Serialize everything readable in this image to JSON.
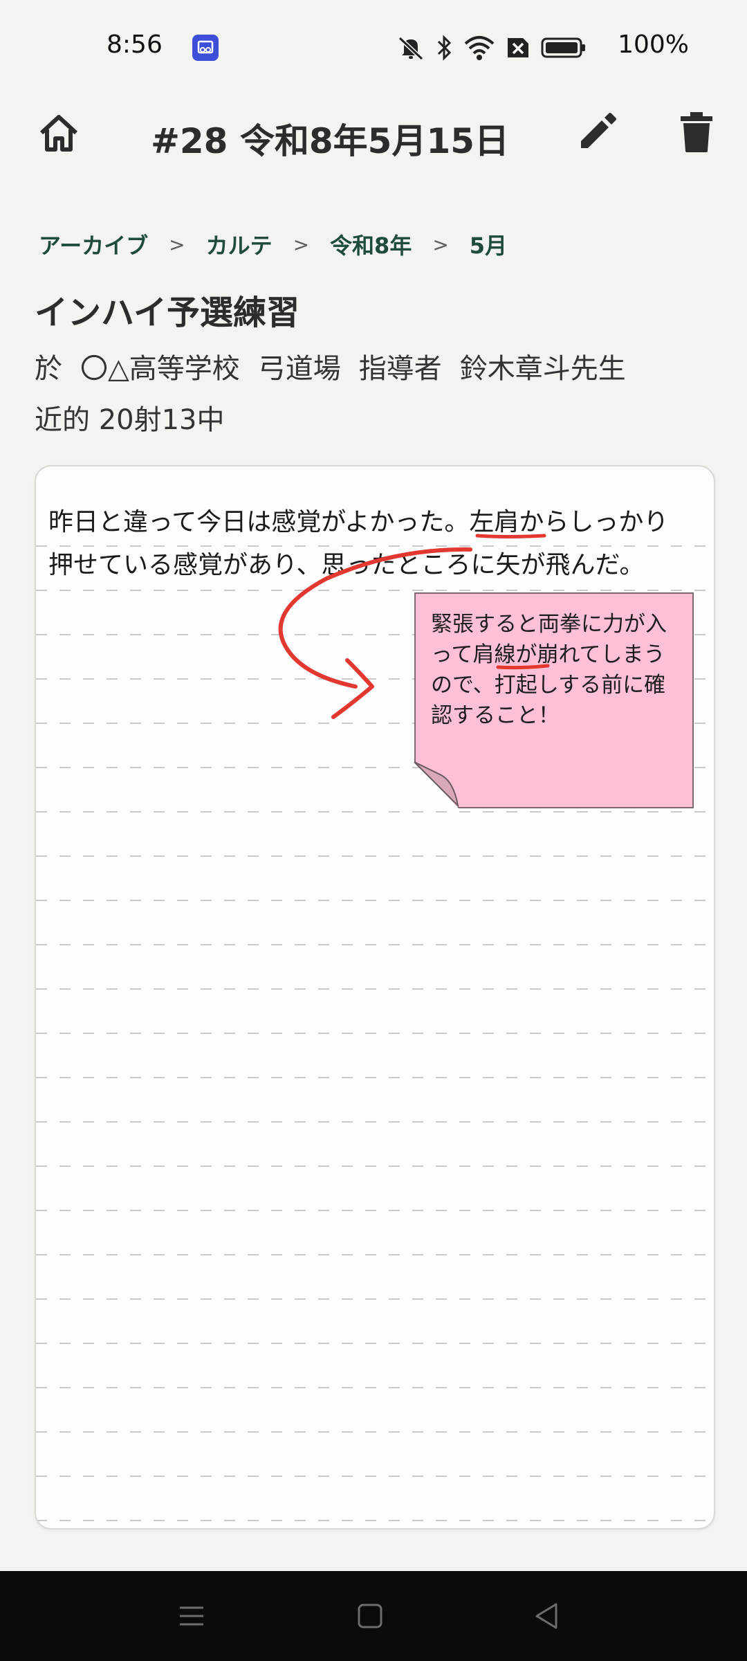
{
  "status_bar": {
    "time": "8:56",
    "battery_percent": "100%",
    "icons": [
      "app-badge-icon",
      "mute-bell-icon",
      "bluetooth-icon",
      "wifi-icon",
      "no-sim-icon",
      "battery-icon"
    ]
  },
  "app_bar": {
    "title": "#28 令和8年5月15日",
    "icons": [
      "home-icon",
      "pencil-icon",
      "trash-icon"
    ]
  },
  "breadcrumb": {
    "items": [
      "アーカイブ",
      "カルテ",
      "令和8年",
      "5月"
    ],
    "separator": ">"
  },
  "entry": {
    "title": "インハイ予選練習",
    "venue_prefix": "於",
    "venue": "〇△高等学校",
    "dojo": "弓道場",
    "instructor_label": "指導者",
    "instructor": "鈴木章斗先生",
    "score": "近的 20射13中"
  },
  "note": {
    "lines": [
      "昨日と違って今日は感覚がよかった。左肩からしっかり",
      "押せている感覚があり、思ったところに矢が飛んだ。"
    ],
    "sticky_text": "緊張すると両拳に力が入って肩線が崩れてしまうので、打起しする前に確認すること！",
    "ink_color": "#e2382f",
    "sticky_color": "#fec0d8"
  },
  "nav_bar": {
    "icons": [
      "menu-icon",
      "square-home-icon",
      "back-triangle-icon"
    ]
  }
}
